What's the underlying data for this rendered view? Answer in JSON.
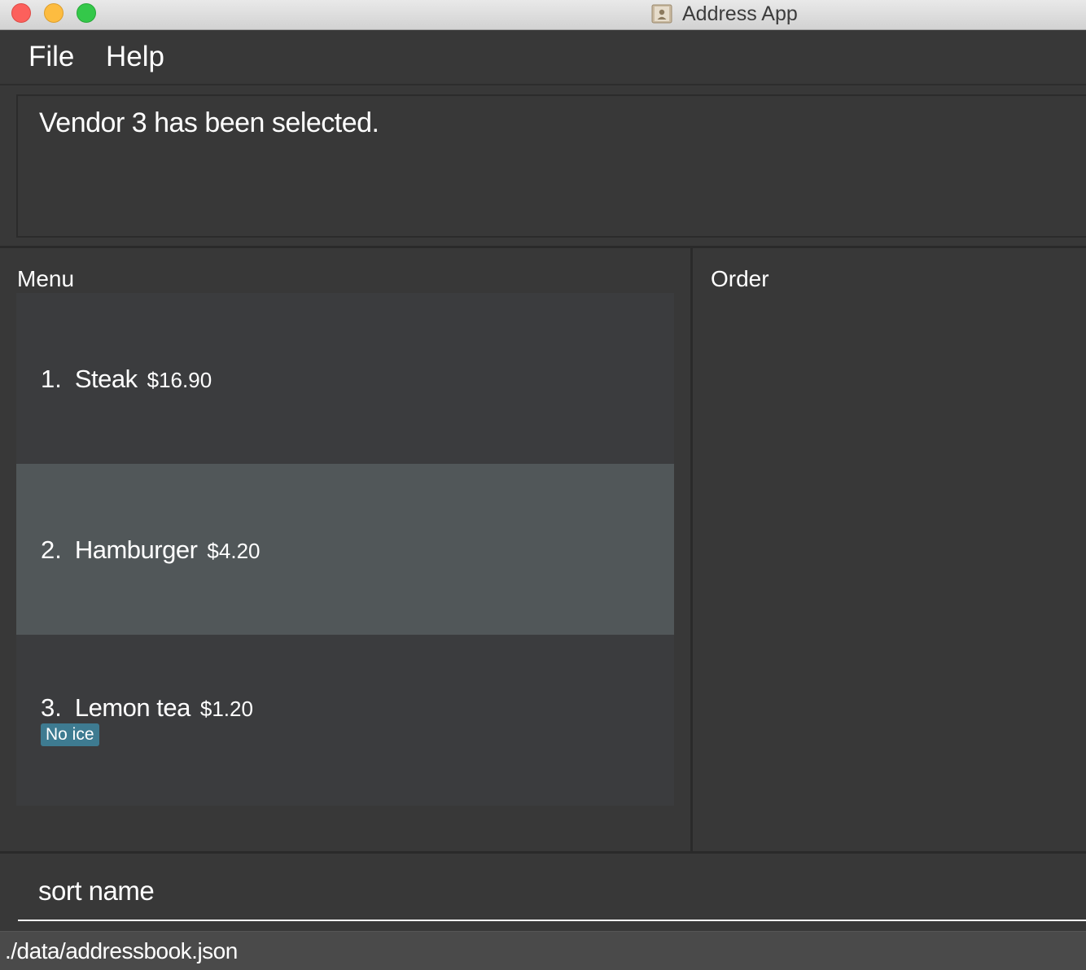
{
  "window": {
    "title": "Address App",
    "icon": "address-book-icon"
  },
  "menubar": {
    "items": [
      {
        "label": "File"
      },
      {
        "label": "Help"
      }
    ]
  },
  "result_display": {
    "text": "Vendor 3 has been selected."
  },
  "menu_panel": {
    "title": "Menu",
    "items": [
      {
        "index": "1.",
        "name": "Steak",
        "price": "$16.90",
        "tags": [],
        "selected": false
      },
      {
        "index": "2.",
        "name": "Hamburger",
        "price": "$4.20",
        "tags": [],
        "selected": true
      },
      {
        "index": "3.",
        "name": "Lemon tea",
        "price": "$1.20",
        "tags": [
          "No ice"
        ],
        "selected": false
      }
    ]
  },
  "order_panel": {
    "title": "Order"
  },
  "command_box": {
    "value": "sort name"
  },
  "status_bar": {
    "path": "./data/addressbook.json"
  },
  "colors": {
    "background": "#383838",
    "list_item": "#3b3c3e",
    "list_item_selected": "#515759",
    "tag": "#3e7b91",
    "status_bar": "#4a4a4a"
  }
}
